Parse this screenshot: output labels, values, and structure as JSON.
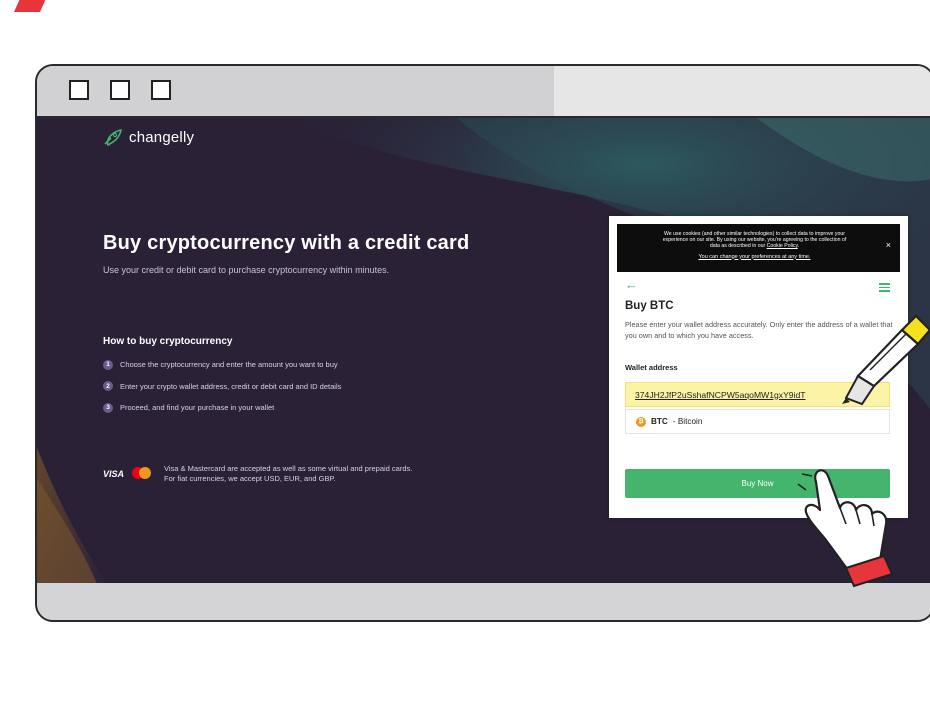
{
  "brand": {
    "name": "changelly"
  },
  "hero": {
    "title": "Buy cryptocurrency with a credit card",
    "subtitle": "Use your credit or debit card to purchase cryptocurrency within minutes."
  },
  "how_to": {
    "title": "How to buy cryptocurrency",
    "steps": [
      {
        "num": "1",
        "text": "Choose the cryptocurrency and enter the amount you want to buy"
      },
      {
        "num": "2",
        "text": "Enter your crypto wallet address, credit or debit card and ID details"
      },
      {
        "num": "3",
        "text": "Proceed, and find your purchase in your wallet"
      }
    ]
  },
  "payment_note": {
    "visa_label": "VISA",
    "line1": "Visa & Mastercard are accepted as well as some virtual and prepaid cards.",
    "line2": "For fiat currencies, we accept USD, EUR, and GBP."
  },
  "cookie_banner": {
    "text_line1": "We use cookies (and other similar technologies) to collect data to improve your",
    "text_line2": "experience on our site. By using our website, you're agreeing to the collection of",
    "text_line3_prefix": "data as described in our",
    "policy_link": "Cookie Policy",
    "change_link": "You can change your preferences at any time.",
    "close_label": "×"
  },
  "widget": {
    "back_label": "←",
    "title": "Buy BTC",
    "description": "Please enter your wallet address accurately. Only enter the address of a wallet that you own and to which you have access.",
    "wallet_label": "Wallet address",
    "wallet_value": "374JH2JfP2uSshafNCPW5aqoMW1gxY9idT",
    "coin_symbol": "BTC",
    "coin_name": "- Bitcoin",
    "coin_icon": "₿",
    "buy_button": "Buy Now"
  },
  "colors": {
    "accent_green": "#45b46d",
    "page_bg": "#2a2137",
    "highlight_yellow": "#fdf3a6",
    "brand_red": "#e8353b"
  },
  "icons": [
    "changelly-logo-icon",
    "back-arrow-icon",
    "hamburger-menu-icon",
    "bitcoin-icon",
    "mastercard-icon",
    "highlighter-marker-icon",
    "pointing-hand-cursor-icon"
  ]
}
